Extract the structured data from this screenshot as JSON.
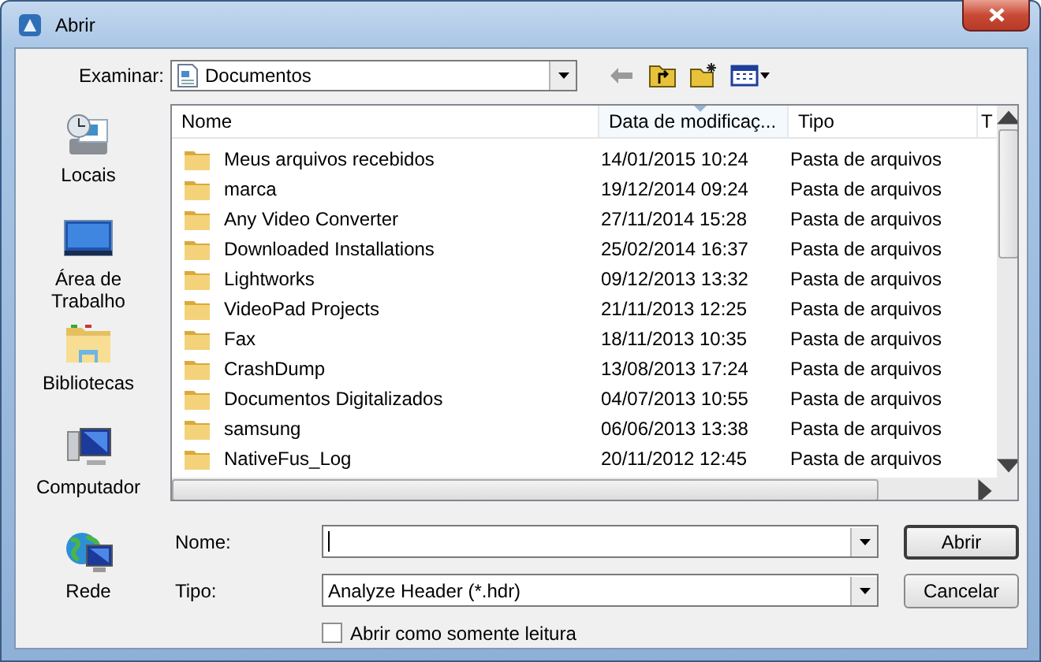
{
  "window": {
    "title": "Abrir"
  },
  "look_in": {
    "label": "Examinar:",
    "value": "Documentos"
  },
  "places": [
    {
      "label": "Locais",
      "kind": "recent"
    },
    {
      "label": "Área de Trabalho",
      "kind": "desktop"
    },
    {
      "label": "Bibliotecas",
      "kind": "libraries"
    },
    {
      "label": "Computador",
      "kind": "computer"
    },
    {
      "label": "Rede",
      "kind": "network"
    }
  ],
  "columns": [
    {
      "label": "Nome",
      "sorted": false
    },
    {
      "label": "Data de modificaç...",
      "sorted": true
    },
    {
      "label": "Tipo",
      "sorted": false
    },
    {
      "label": "T",
      "sorted": false
    }
  ],
  "rows": [
    {
      "name": "Meus arquivos recebidos",
      "date": "14/01/2015 10:24",
      "type": "Pasta de arquivos"
    },
    {
      "name": "marca",
      "date": "19/12/2014 09:24",
      "type": "Pasta de arquivos"
    },
    {
      "name": "Any Video Converter",
      "date": "27/11/2014 15:28",
      "type": "Pasta de arquivos"
    },
    {
      "name": "Downloaded Installations",
      "date": "25/02/2014 16:37",
      "type": "Pasta de arquivos"
    },
    {
      "name": "Lightworks",
      "date": "09/12/2013 13:32",
      "type": "Pasta de arquivos"
    },
    {
      "name": "VideoPad Projects",
      "date": "21/11/2013 12:25",
      "type": "Pasta de arquivos"
    },
    {
      "name": "Fax",
      "date": "18/11/2013 10:35",
      "type": "Pasta de arquivos"
    },
    {
      "name": "CrashDump",
      "date": "13/08/2013 17:24",
      "type": "Pasta de arquivos"
    },
    {
      "name": "Documentos Digitalizados",
      "date": "04/07/2013 10:55",
      "type": "Pasta de arquivos"
    },
    {
      "name": "samsung",
      "date": "06/06/2013 13:38",
      "type": "Pasta de arquivos"
    },
    {
      "name": "NativeFus_Log",
      "date": "20/11/2012 12:45",
      "type": "Pasta de arquivos"
    }
  ],
  "file_name": {
    "label": "Nome:"
  },
  "file_type": {
    "label": "Tipo:",
    "value": "Analyze Header (*.hdr)"
  },
  "read_only": {
    "label": "Abrir como somente leitura",
    "checked": false
  },
  "buttons": [
    {
      "label": "Abrir",
      "default": true
    },
    {
      "label": "Cancelar",
      "default": false
    }
  ]
}
